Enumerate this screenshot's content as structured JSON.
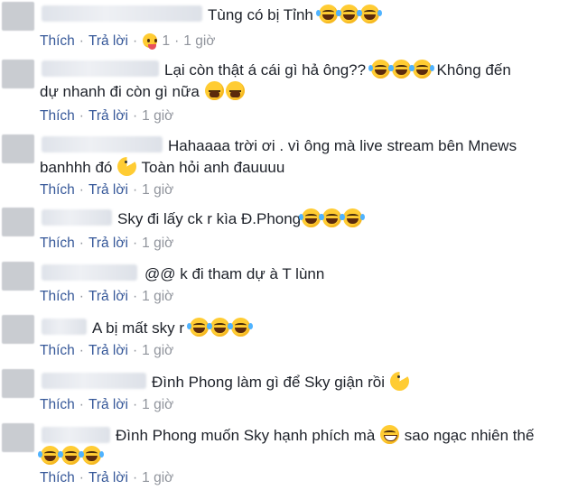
{
  "actions": {
    "like": "Thích",
    "reply": "Trả lời",
    "dot": "·"
  },
  "comments": [
    {
      "text": "Tùng có bị Tỉnh",
      "reaction_count": "1",
      "time": "1 giờ"
    },
    {
      "text": "Lại còn thật á cái gì hả ông??",
      "text2": "Không đến",
      "line2": "dự nhanh đi còn gì nữa",
      "time": "1 giờ"
    },
    {
      "text": "Hahaaaa trời ơi . vì ông mà live stream bên Mnews",
      "line2": "banhhh đó",
      "line2b": "Toàn hỏi anh đauuuu",
      "time": "1 giờ"
    },
    {
      "text": "Sky đi lấy ck r kìa Đ.Phong",
      "time": "1 giờ"
    },
    {
      "text": "@@ k đi tham dự à T lùnn",
      "time": "1 giờ"
    },
    {
      "text": "A bị mất sky r",
      "time": "1 giờ"
    },
    {
      "text": "Đình Phong làm gì để Sky giận rồi",
      "time": "1 giờ"
    },
    {
      "text": "Đình Phong muốn Sky hạnh phích mà",
      "text2": "sao ngạc nhiên thế",
      "time": "1 giờ"
    }
  ],
  "emoji": {
    "laugh": "face-with-tears-of-joy-icon",
    "cry": "loudly-crying-face-icon",
    "pacman": "pacman-icon",
    "grin": "grinning-face-icon",
    "tongue": "tongue-out-face-icon"
  },
  "colors": {
    "link": "#365899",
    "meta": "#90949c",
    "text": "#1d2129",
    "emoji": "#ffcc33"
  }
}
